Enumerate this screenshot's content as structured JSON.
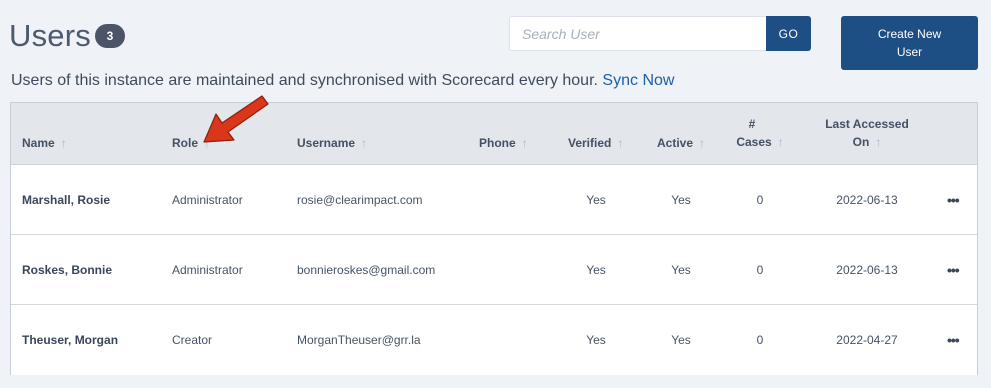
{
  "header": {
    "title": "Users",
    "count": "3"
  },
  "search": {
    "placeholder": "Search User",
    "value": "",
    "go_label": "GO"
  },
  "create_button_label": "Create New User",
  "sync": {
    "message": "Users of this instance are maintained and synchronised with Scorecard every hour.",
    "link_label": "Sync Now"
  },
  "table": {
    "columns": {
      "name": "Name",
      "role": "Role",
      "username": "Username",
      "phone": "Phone",
      "verified": "Verified",
      "active": "Active",
      "cases_line1": "#",
      "cases_line2": "Cases",
      "last_accessed_line1": "Last Accessed",
      "last_accessed_line2": "On"
    },
    "sort_glyph": "↑",
    "rows": [
      {
        "name": "Marshall, Rosie",
        "role": "Administrator",
        "username": "rosie@clearimpact.com",
        "phone": "",
        "verified": "Yes",
        "active": "Yes",
        "cases": "0",
        "last_accessed": "2022-06-13",
        "actions": "•••"
      },
      {
        "name": "Roskes, Bonnie",
        "role": "Administrator",
        "username": "bonnieroskes@gmail.com",
        "phone": "",
        "verified": "Yes",
        "active": "Yes",
        "cases": "0",
        "last_accessed": "2022-06-13",
        "actions": "•••"
      },
      {
        "name": "Theuser, Morgan",
        "role": "Creator",
        "username": "MorganTheuser@grr.la",
        "phone": "",
        "verified": "Yes",
        "active": "Yes",
        "cases": "0",
        "last_accessed": "2022-04-27",
        "actions": "•••"
      }
    ]
  },
  "icons": {
    "sort": "sort-arrow-icon",
    "more": "more-options-icon",
    "annotation": "red-arrow-annotation"
  },
  "colors": {
    "primary": "#1d4f85",
    "link": "#1d5fa8",
    "badge": "#4b5567",
    "annotation": "#d9361c"
  }
}
